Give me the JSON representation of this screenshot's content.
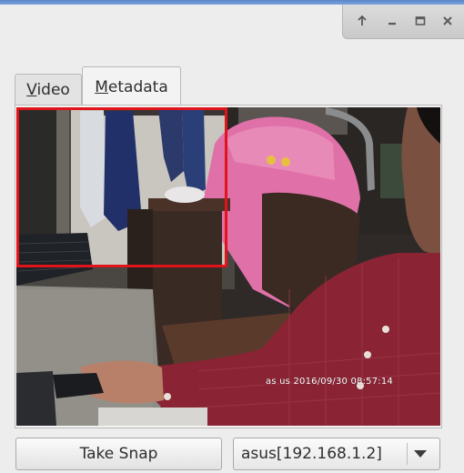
{
  "window_controls": {
    "restore_up": "↑",
    "minimize": "–",
    "maximize": "□",
    "close": "✕"
  },
  "tabs": [
    {
      "label_mnemonic": "V",
      "label_rest": "ideo",
      "active": false
    },
    {
      "label_mnemonic": "M",
      "label_rest": "etadata",
      "active": true
    }
  ],
  "video": {
    "timestamp": "as us 2016/09/30 08:57:14",
    "detection_box_color": "#e0141a"
  },
  "footer": {
    "snap_label": "Take Snap",
    "camera_selected": "asus[192.168.1.2]"
  }
}
